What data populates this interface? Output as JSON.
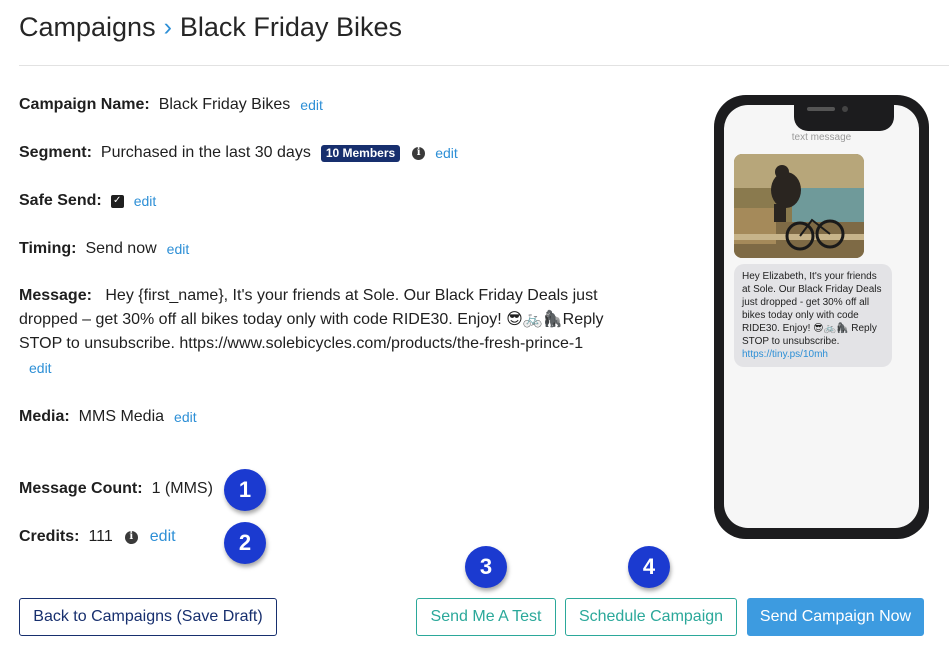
{
  "breadcrumb": {
    "parent": "Campaigns",
    "separator": "›",
    "current": "Black Friday Bikes"
  },
  "fields": {
    "campaign_name": {
      "label": "Campaign Name:",
      "value": "Black Friday Bikes",
      "edit": "edit"
    },
    "segment": {
      "label": "Segment:",
      "value": "Purchased in the last 30 days",
      "badge": "10 Members",
      "edit": "edit"
    },
    "safe_send": {
      "label": "Safe Send:",
      "checked": true,
      "edit": "edit"
    },
    "timing": {
      "label": "Timing:",
      "value": "Send now",
      "edit": "edit"
    },
    "message": {
      "label": "Message:",
      "value": "Hey {first_name}, It's your friends at Sole. Our Black Friday Deals just dropped – get 30% off all bikes today only with code RIDE30. Enjoy! 😎🚲🦍Reply STOP to unsubscribe. https://www.solebicycles.com/products/the-fresh-prince-1",
      "edit": "edit"
    },
    "media": {
      "label": "Media:",
      "value": "MMS Media",
      "edit": "edit"
    },
    "message_count": {
      "label": "Message Count:",
      "value": "1 (MMS)"
    },
    "credits": {
      "label": "Credits:",
      "value": "111",
      "edit": "edit"
    }
  },
  "steps": [
    "1",
    "2",
    "3",
    "4"
  ],
  "buttons": {
    "back": "Back to Campaigns (Save Draft)",
    "test": "Send Me A Test",
    "schedule": "Schedule Campaign",
    "send_now": "Send Campaign Now"
  },
  "preview": {
    "header": "text message",
    "bubble_text": "Hey Elizabeth, It's your friends at Sole. Our Black Friday Deals just dropped - get 30% off all bikes today only with code RIDE30. Enjoy! 😎🚲🦍 Reply STOP to unsubscribe.",
    "link": "https://tiny.ps/10mh"
  },
  "colors": {
    "link_blue": "#2d8fd6",
    "badge_navy": "#172f6e",
    "step_blue": "#1b3ad0",
    "teal": "#2ba89a",
    "primary_button": "#3d9be0"
  }
}
